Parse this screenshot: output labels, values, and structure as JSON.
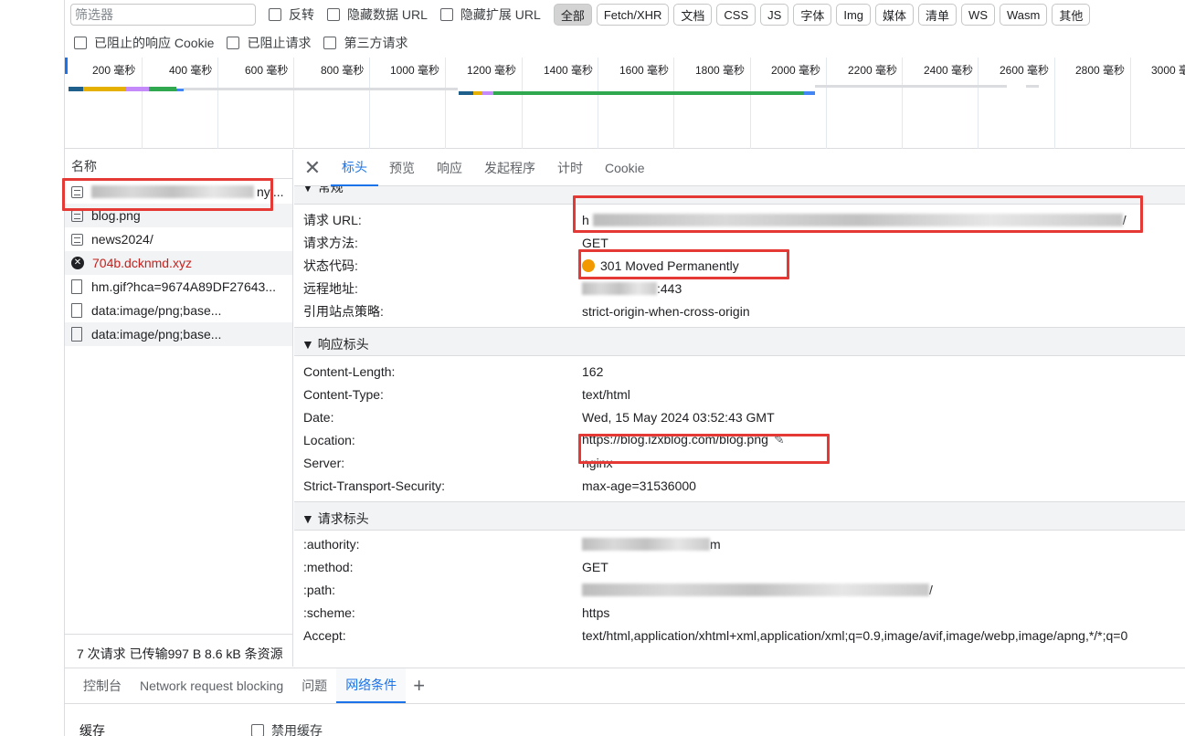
{
  "filter": {
    "placeholder": "筛选器",
    "invert": "反转",
    "hide_data_urls": "隐藏数据 URL",
    "hide_extension_urls": "隐藏扩展 URL",
    "types": [
      "全部",
      "Fetch/XHR",
      "文档",
      "CSS",
      "JS",
      "字体",
      "Img",
      "媒体",
      "清单",
      "WS",
      "Wasm",
      "其他"
    ],
    "active_type": "全部",
    "blocked_cookies": "已阻止的响应 Cookie",
    "blocked_requests": "已阻止请求",
    "third_party": "第三方请求"
  },
  "timeline": {
    "ticks": [
      "200 毫秒",
      "400 毫秒",
      "600 毫秒",
      "800 毫秒",
      "1000 毫秒",
      "1200 毫秒",
      "1400 毫秒",
      "1600 毫秒",
      "1800 毫秒",
      "2000 毫秒",
      "2200 毫秒",
      "2400 毫秒",
      "2600 毫秒",
      "2800 毫秒",
      "3000 毫秒"
    ]
  },
  "request_list": {
    "header": "名称",
    "items": [
      {
        "name": "nyi...",
        "icon": "document-icon",
        "error": false,
        "blurred": true
      },
      {
        "name": "blog.png",
        "icon": "document-icon",
        "error": false,
        "blurred": false
      },
      {
        "name": "news2024/",
        "icon": "document-icon",
        "error": false,
        "blurred": false
      },
      {
        "name": "704b.dcknmd.xyz",
        "icon": "error-icon",
        "error": true,
        "blurred": false
      },
      {
        "name": "hm.gif?hca=9674A89DF27643...",
        "icon": "file-icon",
        "error": false,
        "blurred": false
      },
      {
        "name": "data:image/png;base...",
        "icon": "file-icon",
        "error": false,
        "blurred": false
      },
      {
        "name": "data:image/png;base...",
        "icon": "file-icon",
        "error": false,
        "blurred": false
      }
    ],
    "summary": "7 次请求  已传输997 B  8.6 kB 条资源"
  },
  "details": {
    "close_icon": "close-icon",
    "tabs": [
      "标头",
      "预览",
      "响应",
      "发起程序",
      "计时",
      "Cookie"
    ],
    "active_tab": "标头",
    "general": {
      "title": "▼ 常规",
      "request_url_label": "请求 URL:",
      "request_url_value": "h",
      "request_url_tail": "/",
      "method_label": "请求方法:",
      "method_value": "GET",
      "status_label": "状态代码:",
      "status_value": "301 Moved Permanently",
      "status_color": "#f29900",
      "remote_label": "远程地址:",
      "remote_value": ":443",
      "referrer_label": "引用站点策略:",
      "referrer_value": "strict-origin-when-cross-origin"
    },
    "response_headers": {
      "title": "▼ 响应标头",
      "rows": [
        {
          "k": "Content-Length:",
          "v": "162"
        },
        {
          "k": "Content-Type:",
          "v": "text/html"
        },
        {
          "k": "Date:",
          "v": "Wed, 15 May 2024 03:52:43 GMT"
        },
        {
          "k": "Location:",
          "v": "https://blog.izxblog.com/blog.png"
        },
        {
          "k": "Server:",
          "v": "nginx"
        },
        {
          "k": "Strict-Transport-Security:",
          "v": "max-age=31536000"
        }
      ]
    },
    "request_headers": {
      "title": "▼ 请求标头",
      "rows": [
        {
          "k": ":authority:",
          "v": "m"
        },
        {
          "k": ":method:",
          "v": "GET"
        },
        {
          "k": ":path:",
          "v": "/"
        },
        {
          "k": ":scheme:",
          "v": "https"
        },
        {
          "k": "Accept:",
          "v": "text/html,application/xhtml+xml,application/xml;q=0.9,image/avif,image/webp,image/apng,*/*;q=0"
        }
      ]
    }
  },
  "drawer": {
    "tabs": [
      "控制台",
      "Network request blocking",
      "问题",
      "网络条件"
    ],
    "active_tab": "网络条件",
    "add_label": "+",
    "cache_label": "缓存",
    "disable_cache": "禁用缓存"
  },
  "colors": {
    "accent": "#1a73e8",
    "highlight_box": "#e53935"
  }
}
